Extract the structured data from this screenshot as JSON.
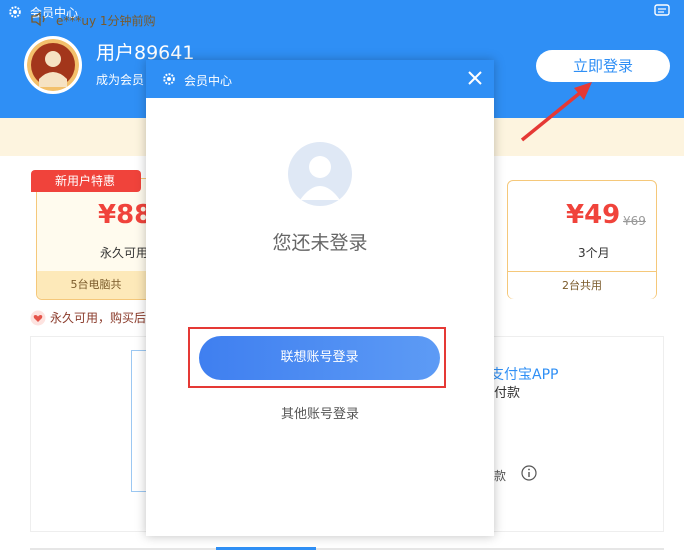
{
  "background_window": {
    "title": "会员中心",
    "username": "用户89641",
    "become_member": "成为会员",
    "login_button": "立即登录",
    "notice_text": "e***uy 1分钟前购",
    "plans": [
      {
        "badge": "新用户特惠",
        "price": "¥88",
        "desc": "永久可用",
        "foot": "5台电脑共"
      },
      {
        "price": "¥49",
        "old_price": "¥69",
        "desc": "3个月",
        "foot": "2台共用"
      }
    ],
    "permanent_note": "永久可用，购买后",
    "alipay": {
      "title": "支付宝APP",
      "subtitle": "付款",
      "footer": "款"
    }
  },
  "modal": {
    "title": "会员中心",
    "status_text": "您还未登录",
    "lenovo_login_button": "联想账号登录",
    "other_login_link": "其他账号登录"
  },
  "colors": {
    "primary_blue": "#2f8ff5",
    "accent_red": "#f0433b",
    "highlight_border": "#e53935",
    "notice_bg": "#fdf4df"
  }
}
